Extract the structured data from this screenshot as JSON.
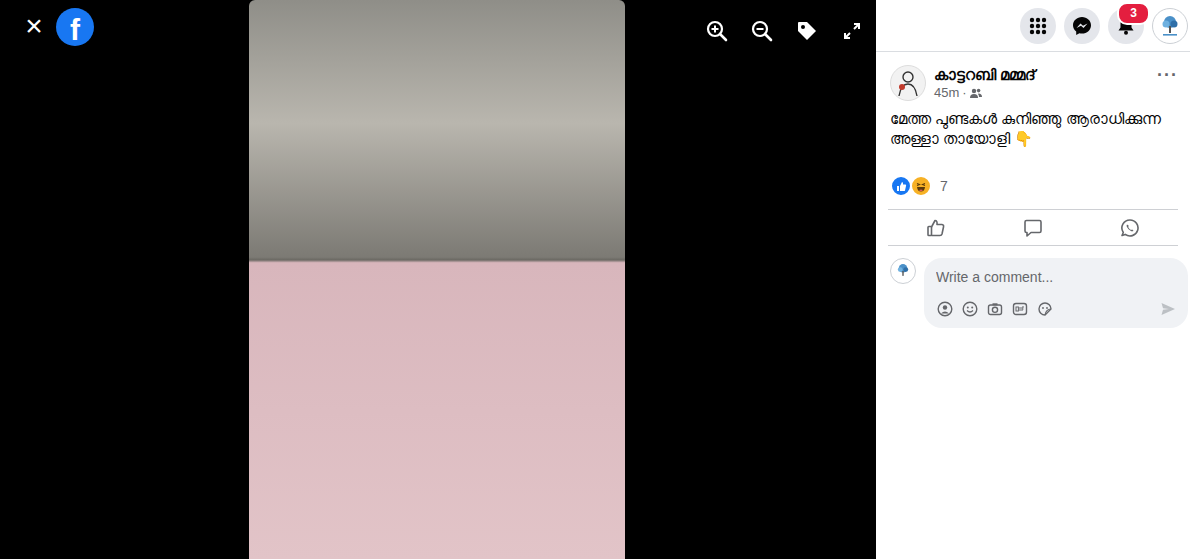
{
  "viewer": {
    "close": "×",
    "logo": "f"
  },
  "top_bar": {
    "notifications": {
      "count": "3"
    }
  },
  "post": {
    "author": "കാട്ടറബി മമ്മദ്",
    "time": "45m",
    "separator": "·",
    "more": "···",
    "caption": "മേത്ത പുണ്ടകൾ കുനിഞ്ഞു ആരാധിക്കുന്ന അള്ളാ തായോളി 👇"
  },
  "reactions": {
    "count": "7"
  },
  "comment": {
    "placeholder": "Write a comment..."
  }
}
